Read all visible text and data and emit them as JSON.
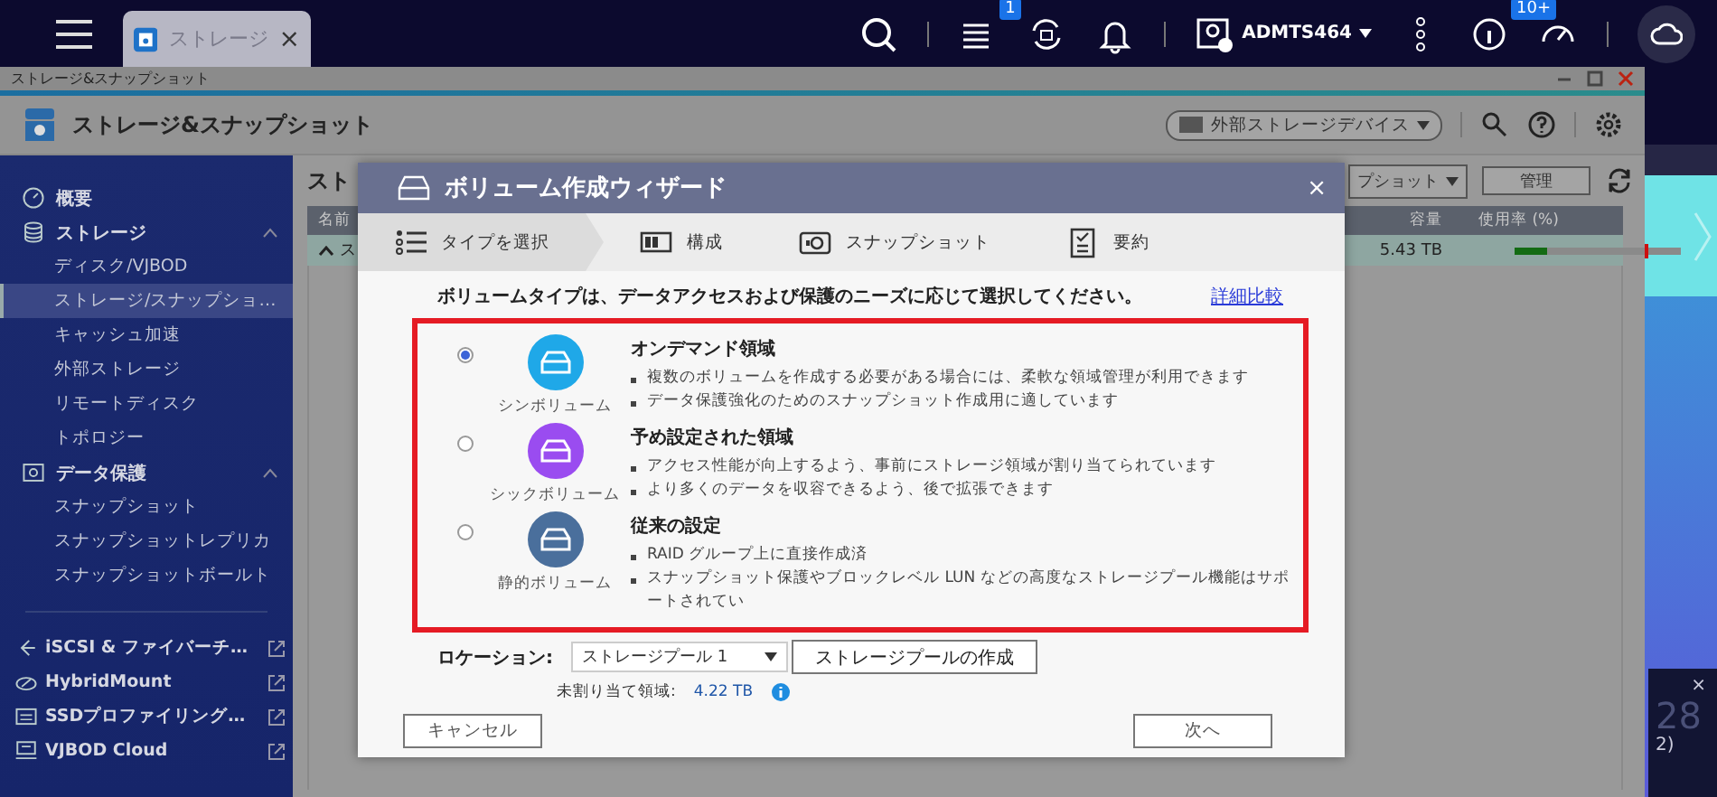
{
  "top_bar": {
    "tab": {
      "label": "ストレージ",
      "close": "×"
    },
    "tasks_badge": "1",
    "user": "ADMTS464",
    "info_badge": "10+"
  },
  "window": {
    "title": "ストレージ&スナップショット",
    "header_title": "ストレージ&スナップショット",
    "device_dropdown": "外部ストレージデバイス"
  },
  "sidebar": {
    "items": [
      {
        "label": "概要"
      },
      {
        "label": "ストレージ",
        "expanded": true,
        "children": [
          {
            "label": "ディスク/VJBOD",
            "selected": false
          },
          {
            "label": "ストレージ/スナップショ…",
            "selected": true
          },
          {
            "label": "キャッシュ加速",
            "selected": false
          },
          {
            "label": "外部ストレージ",
            "selected": false
          },
          {
            "label": "リモートディスク",
            "selected": false
          },
          {
            "label": "トポロジー",
            "selected": false
          }
        ]
      },
      {
        "label": "データ保護",
        "expanded": true,
        "children": [
          {
            "label": "スナップショット",
            "selected": false
          },
          {
            "label": "スナップショットレプリカ",
            "selected": false
          },
          {
            "label": "スナップショットボールト",
            "selected": false
          }
        ]
      }
    ],
    "links": [
      {
        "label": "iSCSI & ファイバーチ…"
      },
      {
        "label": "HybridMount"
      },
      {
        "label": "SSDプロファイリング…"
      },
      {
        "label": "VJBOD Cloud"
      }
    ]
  },
  "main": {
    "heading": "スト",
    "snapshot_dropdown": "プショット",
    "manage_button": "管理",
    "table": {
      "columns": [
        "名前",
        "容量",
        "使用率 (%)"
      ],
      "row": {
        "name": "ス",
        "capacity": "5.43 TB",
        "level": 0.2
      }
    }
  },
  "wizard": {
    "title": "ボリューム作成ウィザード",
    "close": "×",
    "steps": [
      {
        "label": "タイプを選択",
        "selected": true
      },
      {
        "label": "構成",
        "selected": false
      },
      {
        "label": "スナップショット",
        "selected": false
      },
      {
        "label": "要約",
        "selected": false
      }
    ],
    "intro": "ボリュームタイプは、データアクセスおよび保護のニーズに応じて選択してください。",
    "compare_link": "詳細比較",
    "options": [
      {
        "selected": true,
        "type_label": "シンボリューム",
        "color": "#1fa8e8",
        "title": "オンデマンド領域",
        "bullets": [
          "複数のボリュームを作成する必要がある場合には、柔軟な領域管理が利用できます",
          "データ保護強化のためのスナップショット作成用に適しています"
        ]
      },
      {
        "selected": false,
        "type_label": "シックボリューム",
        "color": "#9a4cf0",
        "title": "予め設定された領域",
        "bullets": [
          "アクセス性能が向上するよう、事前にストレージ領域が割り当てられています",
          "より多くのデータを収容できるよう、後で拡張できます"
        ]
      },
      {
        "selected": false,
        "type_label": "静的ボリューム",
        "color": "#4a6f9c",
        "title": "従来の設定",
        "bullets": [
          "RAID グループ上に直接作成済",
          "スナップショット保護やブロックレベル LUN などの高度なストレージプール機能はサポートされてい"
        ]
      }
    ],
    "location_label": "ロケーション:",
    "location_value": "ストレージプール 1",
    "create_pool_button": "ストレージプールの作成",
    "unallocated_label": "未割り当て領域:",
    "unallocated_value": "4.22 TB",
    "cancel_button": "キャンセル",
    "next_button": "次へ"
  },
  "desktop": {
    "notification": {
      "close": "×",
      "number": "28",
      "text": "2)"
    }
  }
}
